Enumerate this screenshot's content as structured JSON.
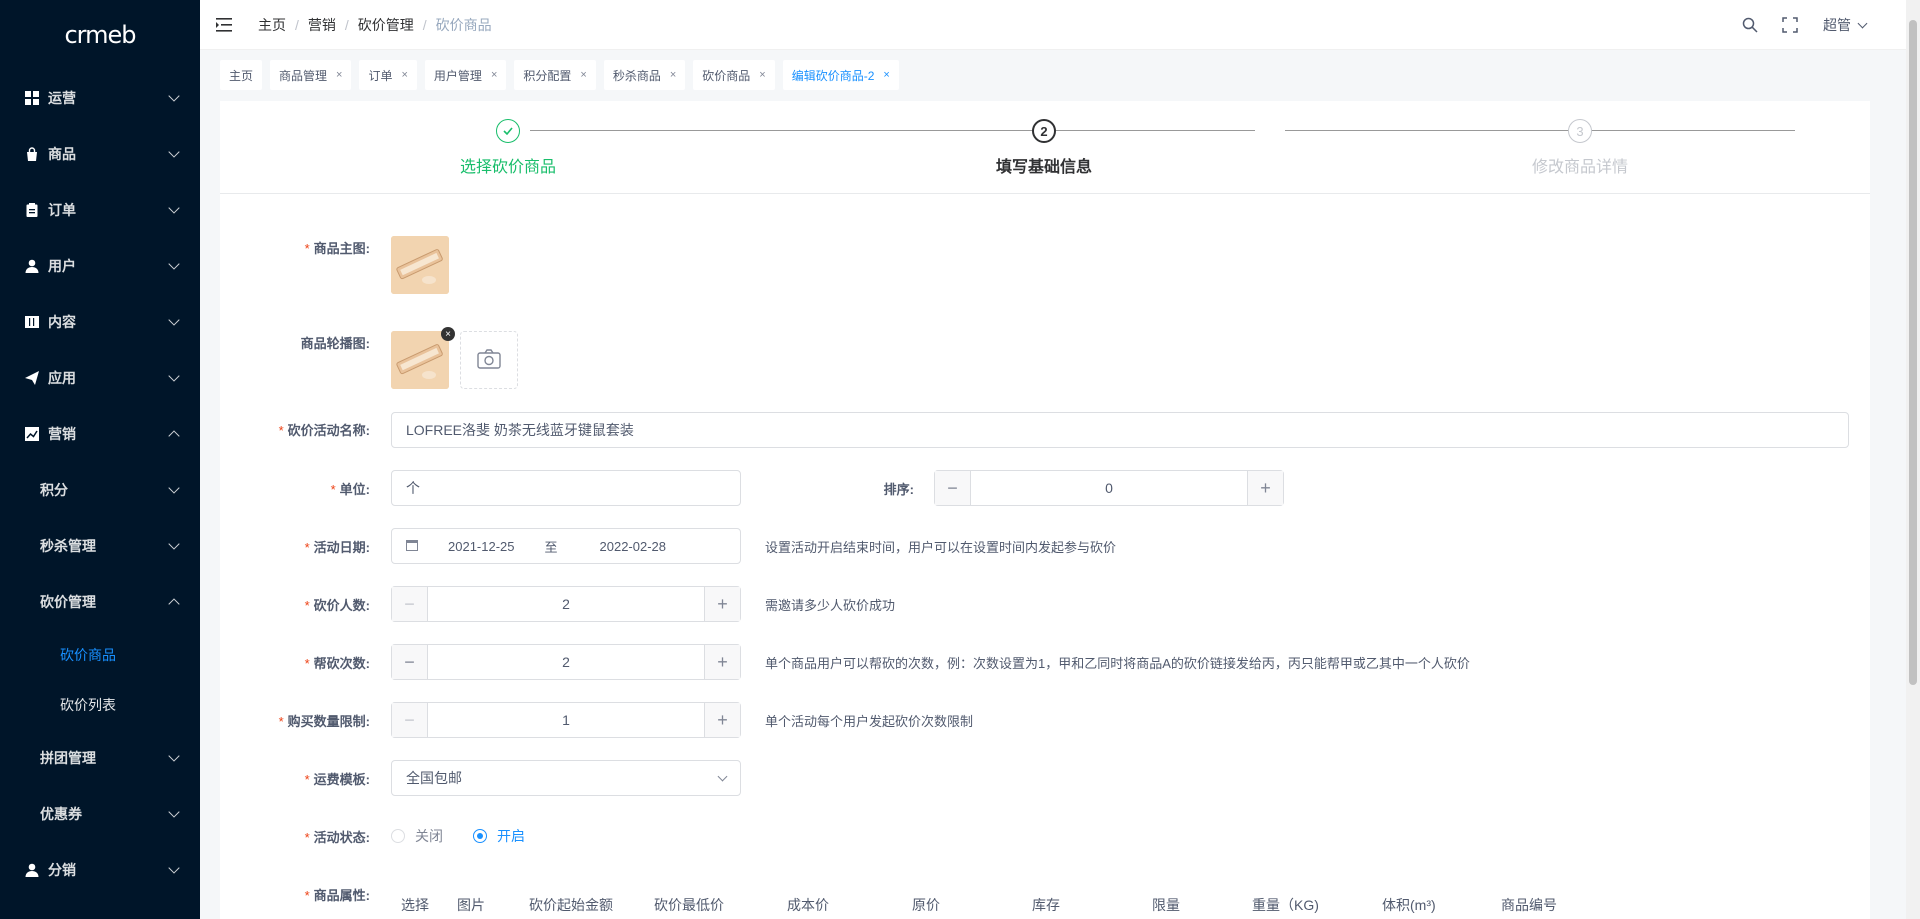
{
  "sidebar": {
    "logo": "crmeb",
    "menu": [
      {
        "label": "运营",
        "icon": "grid-icon"
      },
      {
        "label": "商品",
        "icon": "bag-icon"
      },
      {
        "label": "订单",
        "icon": "clipboard-icon"
      },
      {
        "label": "用户",
        "icon": "user-icon"
      },
      {
        "label": "内容",
        "icon": "book-icon"
      },
      {
        "label": "应用",
        "icon": "send-icon"
      },
      {
        "label": "营销",
        "icon": "chart-icon"
      }
    ],
    "marketing_sub": [
      {
        "label": "积分"
      },
      {
        "label": "秒杀管理"
      },
      {
        "label": "砍价管理"
      }
    ],
    "bargain_leaves": [
      {
        "label": "砍价商品"
      },
      {
        "label": "砍价列表"
      }
    ],
    "marketing_sub2": [
      {
        "label": "拼团管理"
      },
      {
        "label": "优惠券"
      }
    ],
    "menu_bottom": [
      {
        "label": "分销",
        "icon": "user-icon"
      }
    ]
  },
  "header": {
    "breadcrumb": [
      "主页",
      "营销",
      "砍价管理",
      "砍价商品"
    ],
    "user": "超管"
  },
  "tags": [
    {
      "label": "主页",
      "closable": false
    },
    {
      "label": "商品管理",
      "closable": true
    },
    {
      "label": "订单",
      "closable": true
    },
    {
      "label": "用户管理",
      "closable": true
    },
    {
      "label": "积分配置",
      "closable": true
    },
    {
      "label": "秒杀商品",
      "closable": true
    },
    {
      "label": "砍价商品",
      "closable": true
    },
    {
      "label": "编辑砍价商品-2",
      "closable": true
    }
  ],
  "tag_close": "×",
  "steps": [
    {
      "label": "选择砍价商品",
      "status": "done",
      "num": "✓"
    },
    {
      "label": "填写基础信息",
      "status": "current",
      "num": "2"
    },
    {
      "label": "修改商品详情",
      "status": "wait",
      "num": "3"
    }
  ],
  "form": {
    "main_image_label": "商品主图:",
    "carousel_label": "商品轮播图:",
    "name_label": "砍价活动名称:",
    "name_value": "LOFREE洛斐 奶茶无线蓝牙键鼠套装",
    "unit_label": "单位:",
    "unit_value": "个",
    "sort_label": "排序:",
    "sort_value": "0",
    "date_label": "活动日期:",
    "date_start": "2021-12-25",
    "date_sep": "至",
    "date_end": "2022-02-28",
    "date_hint": "设置活动开启结束时间，用户可以在设置时间内发起参与砍价",
    "people_label": "砍价人数:",
    "people_value": "2",
    "people_hint": "需邀请多少人砍价成功",
    "help_label": "帮砍次数:",
    "help_value": "2",
    "help_hint": "单个商品用户可以帮砍的次数，例：次数设置为1，甲和乙同时将商品A的砍价链接发给丙，丙只能帮甲或乙其中一个人砍价",
    "limit_label": "购买数量限制:",
    "limit_value": "1",
    "limit_hint": "单个活动每个用户发起砍价次数限制",
    "shipping_label": "运费模板:",
    "shipping_value": "全国包邮",
    "status_label": "活动状态:",
    "status_off": "关闭",
    "status_on": "开启",
    "status_selected": "on",
    "attr_label": "商品属性:",
    "attr_columns": [
      "选择",
      "图片",
      "砍价起始金额",
      "砍价最低价",
      "成本价",
      "原价",
      "库存",
      "限量",
      "重量（KG)",
      "体积(m³)",
      "商品编号"
    ]
  },
  "colors": {
    "sidebar_bg": "#001529",
    "accent": "#1890ff",
    "success": "#19be6b",
    "required": "#ed4014"
  }
}
